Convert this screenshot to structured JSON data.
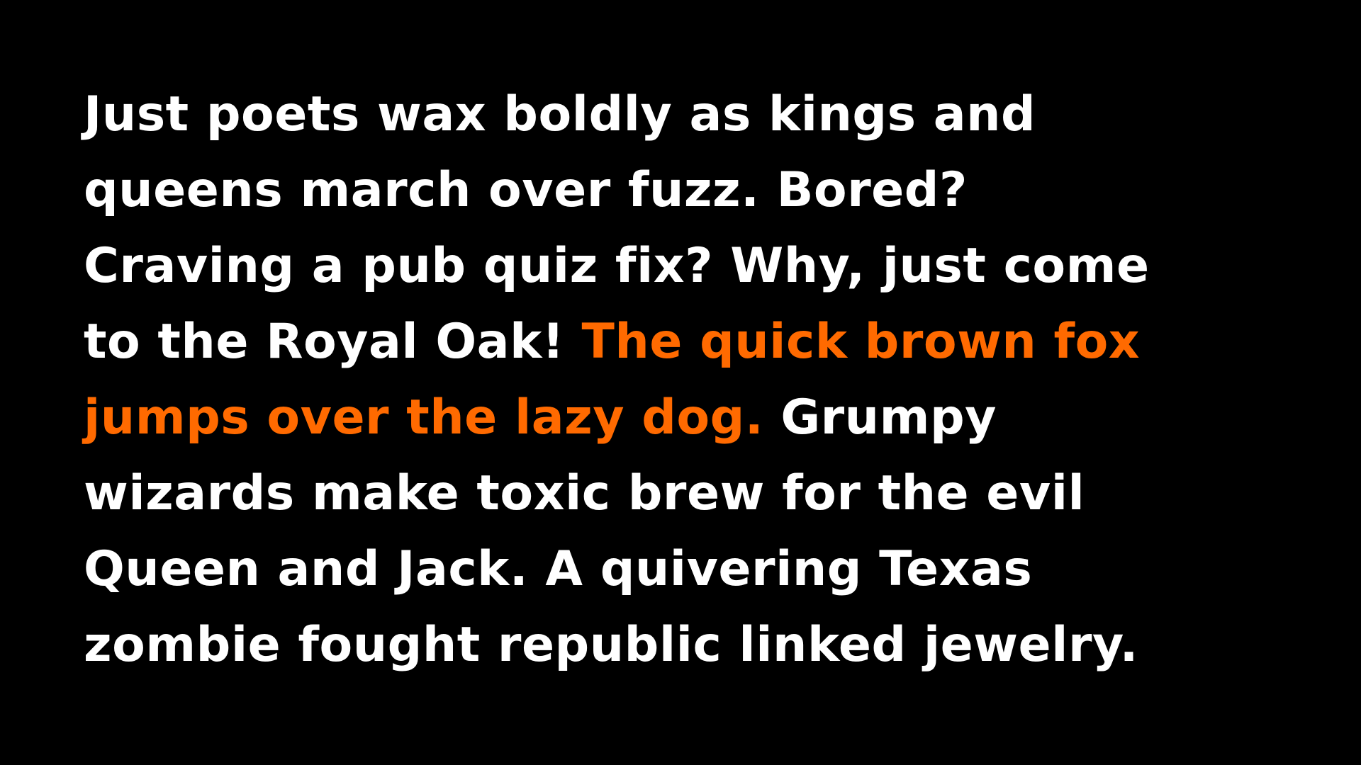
{
  "colors": {
    "background": "#000000",
    "text": "#ffffff",
    "highlight": "#ff6a00"
  },
  "specimen": {
    "lines": [
      {
        "text": "Just poets wax boldly as kings and"
      },
      {
        "text": "queens march over fuzz. Bored?"
      },
      {
        "text": "Craving a pub quiz fix? Why, just come"
      },
      {
        "text": "to the Royal Oak! ",
        "highlight": "The quick brown fox"
      },
      {
        "highlight": "jumps over the lazy dog.",
        "text": " Grumpy"
      },
      {
        "text": "wizards make toxic brew for the evil"
      },
      {
        "text": "Queen and Jack. A quivering Texas"
      },
      {
        "text": "zombie fought republic linked jewelry."
      }
    ]
  }
}
